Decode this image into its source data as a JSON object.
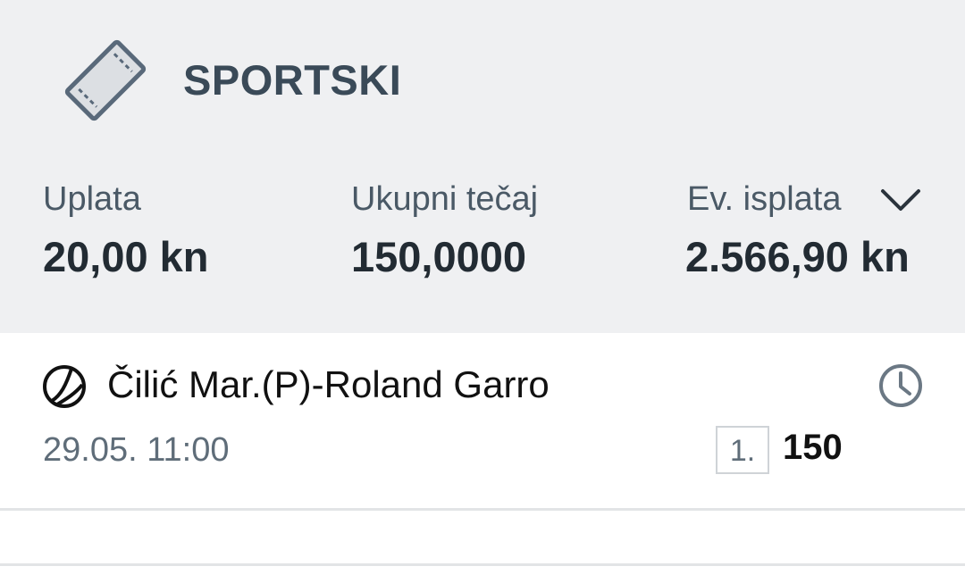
{
  "header": {
    "title": "SPORTSKI",
    "ticket_icon": "ticket-icon",
    "stats": [
      {
        "label": "Uplata",
        "value": "20,00 kn"
      },
      {
        "label": "Ukupni tečaj",
        "value": "150,0000"
      },
      {
        "label": "Ev. isplata",
        "value": "2.566,90 kn"
      }
    ],
    "expand_icon": "chevron-down-icon"
  },
  "match": {
    "sport_icon": "tennis-ball-icon",
    "name": "Čilić Mar.(P)-Roland Garro",
    "datetime": "29.05. 11:00",
    "status_icon": "clock-icon",
    "pick": "1.",
    "odd": "150"
  },
  "colors": {
    "header_bg": "#eff0f2",
    "title": "#3a4a58",
    "label": "#4a5966",
    "value": "#222b33",
    "muted": "#5f6d79"
  }
}
